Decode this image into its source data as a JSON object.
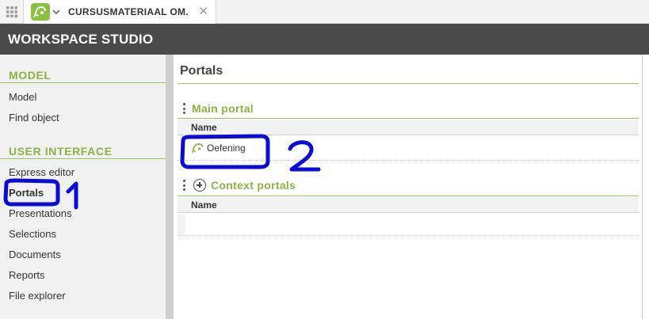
{
  "tab": {
    "title": "CURSUSMATERIAAL OM...",
    "close_glyph": "✕",
    "icons": {
      "apps": "grid-icon",
      "logo": "portal-icon",
      "menu": "chevron-down-icon",
      "close": "close-icon"
    }
  },
  "app": {
    "title": "WORKSPACE STUDIO"
  },
  "sidebar": {
    "sections": [
      {
        "heading": "MODEL",
        "items": [
          {
            "label": "Model"
          },
          {
            "label": "Find object"
          }
        ]
      },
      {
        "heading": "USER INTERFACE",
        "items": [
          {
            "label": "Express editor"
          },
          {
            "label": "Portals",
            "active": true
          },
          {
            "label": "Presentations"
          },
          {
            "label": "Selections"
          },
          {
            "label": "Documents"
          },
          {
            "label": "Reports"
          },
          {
            "label": "File explorer"
          }
        ]
      }
    ]
  },
  "main": {
    "title": "Portals",
    "main_portal": {
      "title": "Main portal",
      "column": "Name",
      "rows": [
        {
          "name": "Oefening",
          "icon": "portal-icon"
        }
      ]
    },
    "context_portals": {
      "title": "Context portals",
      "column": "Name",
      "rows": []
    }
  },
  "annotations": {
    "color": "#0b0bd6",
    "labels": [
      "1",
      "2"
    ]
  },
  "colors": {
    "accent": "#8ab441",
    "titlebar": "#4b4b4b",
    "sidebar": "#f1f1f1"
  }
}
